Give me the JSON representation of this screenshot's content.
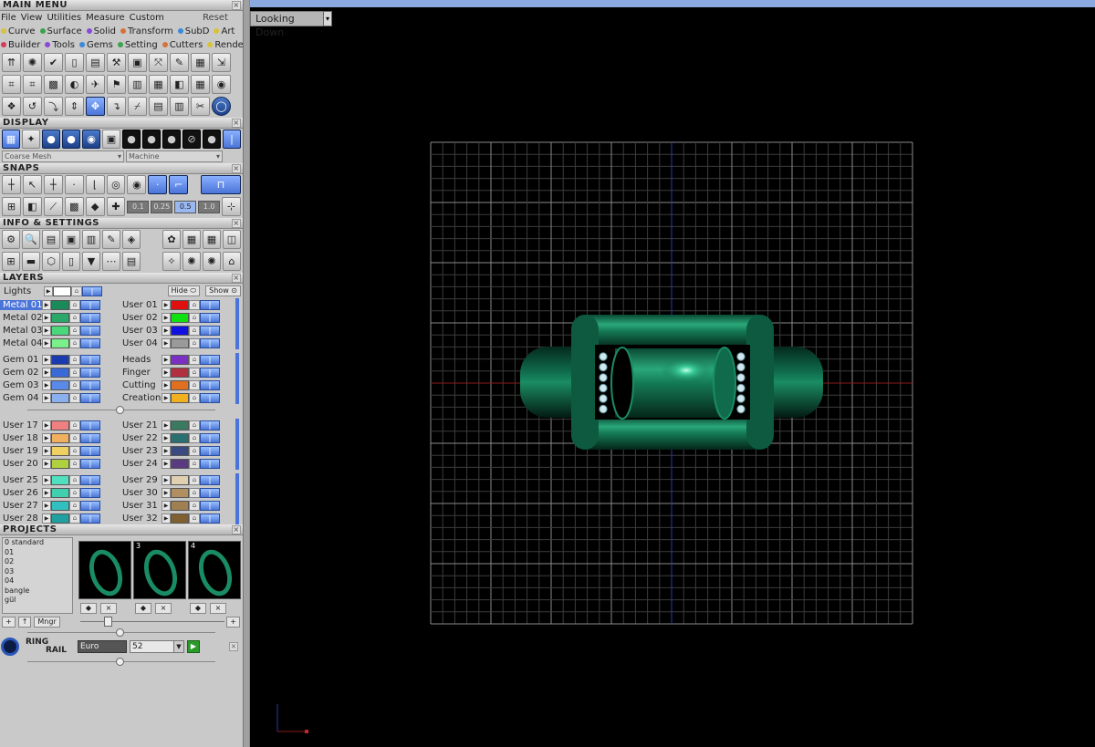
{
  "main_menu": {
    "title": "MAIN MENU",
    "items": [
      "File",
      "View",
      "Utilities",
      "Measure",
      "Custom"
    ],
    "reset": "Reset",
    "row2": [
      {
        "label": "Curve",
        "color": "#d8c23a"
      },
      {
        "label": "Surface",
        "color": "#3aa34b"
      },
      {
        "label": "Solid",
        "color": "#8a4ad8"
      },
      {
        "label": "Transform",
        "color": "#d8703a"
      },
      {
        "label": "SubD",
        "color": "#3a8ad8"
      },
      {
        "label": "Art",
        "color": "#d8c23a"
      }
    ],
    "row3": [
      {
        "label": "Builder",
        "color": "#d83a5a"
      },
      {
        "label": "Tools",
        "color": "#8a4ad8"
      },
      {
        "label": "Gems",
        "color": "#3a8ad8"
      },
      {
        "label": "Setting",
        "color": "#3aa34b"
      },
      {
        "label": "Cutters",
        "color": "#d8703a"
      },
      {
        "label": "Render",
        "color": "#d8c23a"
      }
    ]
  },
  "display": {
    "title": "DISPLAY",
    "mesh": "Coarse Mesh",
    "material": "Machine"
  },
  "snaps": {
    "title": "SNAPS",
    "values": [
      "0.1",
      "0.25",
      "0.5",
      "1.0"
    ]
  },
  "info": {
    "title": "INFO & SETTINGS"
  },
  "layers": {
    "title": "LAYERS",
    "lights": "Lights",
    "hide": "Hide",
    "show": "Show",
    "groups": [
      {
        "left": [
          {
            "name": "Metal 01",
            "color": "#1a8a5a"
          },
          {
            "name": "Metal 02",
            "color": "#2aa86a"
          },
          {
            "name": "Metal 03",
            "color": "#4ad87a"
          },
          {
            "name": "Metal 04",
            "color": "#7af08a"
          }
        ],
        "right": [
          {
            "name": "User 01",
            "color": "#e01010"
          },
          {
            "name": "User 02",
            "color": "#10e010"
          },
          {
            "name": "User 03",
            "color": "#1010e0"
          },
          {
            "name": "User 04",
            "color": "#9a9a9a"
          }
        ]
      },
      {
        "left": [
          {
            "name": "Gem 01",
            "color": "#1a3ab0"
          },
          {
            "name": "Gem 02",
            "color": "#3a6ad8"
          },
          {
            "name": "Gem 03",
            "color": "#5a8ae8"
          },
          {
            "name": "Gem 04",
            "color": "#8ab0f0"
          }
        ],
        "right": [
          {
            "name": "Heads",
            "color": "#7a30c0"
          },
          {
            "name": "Finger",
            "color": "#b03040"
          },
          {
            "name": "Cutting",
            "color": "#e07020"
          },
          {
            "name": "Creation",
            "color": "#f0b020"
          }
        ]
      },
      {
        "left": [
          {
            "name": "User 17",
            "color": "#f08080"
          },
          {
            "name": "User 18",
            "color": "#f0b060"
          },
          {
            "name": "User 19",
            "color": "#f0d060"
          },
          {
            "name": "User 20",
            "color": "#b0d040"
          }
        ],
        "right": [
          {
            "name": "User 21",
            "color": "#3a7a60"
          },
          {
            "name": "User 22",
            "color": "#2a7070"
          },
          {
            "name": "User 23",
            "color": "#3a4a80"
          },
          {
            "name": "User 24",
            "color": "#5a3a80"
          }
        ]
      },
      {
        "left": [
          {
            "name": "User 25",
            "color": "#50e0c0"
          },
          {
            "name": "User 26",
            "color": "#40d0b0"
          },
          {
            "name": "User 27",
            "color": "#30c0c0"
          },
          {
            "name": "User 28",
            "color": "#20a0a0"
          }
        ],
        "right": [
          {
            "name": "User 29",
            "color": "#e0d0b0"
          },
          {
            "name": "User 30",
            "color": "#b09060"
          },
          {
            "name": "User 31",
            "color": "#a08050"
          },
          {
            "name": "User 32",
            "color": "#806030"
          }
        ]
      }
    ]
  },
  "projects": {
    "title": "PROJECTS",
    "list": [
      "0 standard",
      "01",
      "02",
      "03",
      "04",
      "bangle",
      "gül"
    ],
    "thumbs": [
      "",
      "3",
      "4"
    ],
    "mngr": "Mngr"
  },
  "ring_rail": {
    "title_a": "RING",
    "title_b": "RAIL",
    "standard": "Euro",
    "size": "52"
  },
  "viewport": {
    "label": "Looking Down"
  }
}
